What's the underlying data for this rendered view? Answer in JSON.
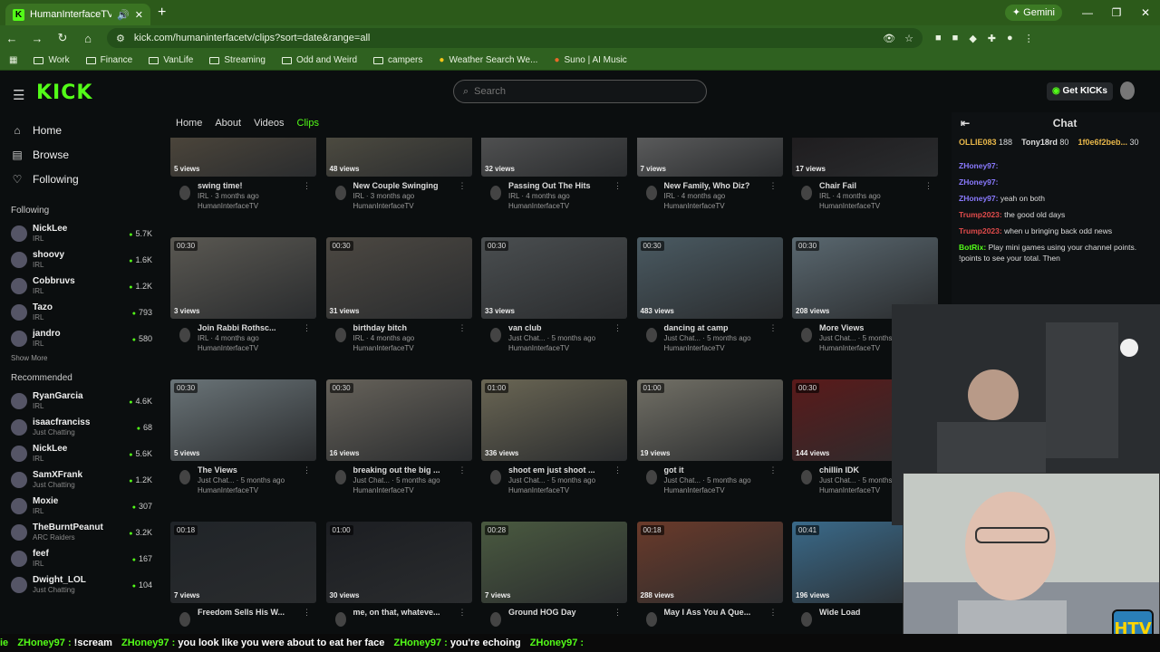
{
  "browser": {
    "tab_title": "HumanInterfaceTV Clips - V",
    "gemini_label": "Gemini",
    "url": "kick.com/humaninterfacetv/clips?sort=date&range=all",
    "bookmarks": [
      "Work",
      "Finance",
      "VanLife",
      "Streaming",
      "Odd and Weird",
      "campers",
      "Weather Search We...",
      "Suno | AI Music"
    ]
  },
  "site": {
    "logo": "KICK",
    "search_placeholder": "Search",
    "get_kicks": "Get KICKs"
  },
  "sidebar": {
    "nav": [
      "Home",
      "Browse",
      "Following"
    ],
    "following_header": "Following",
    "following": [
      {
        "name": "NickLee",
        "category": "IRL",
        "count": "5.7K"
      },
      {
        "name": "shoovy",
        "category": "IRL",
        "count": "1.6K"
      },
      {
        "name": "Cobbruvs",
        "category": "IRL",
        "count": "1.2K"
      },
      {
        "name": "Tazo",
        "category": "IRL",
        "count": "793"
      },
      {
        "name": "jandro",
        "category": "IRL",
        "count": "580"
      }
    ],
    "show_more": "Show More",
    "recommended_header": "Recommended",
    "recommended": [
      {
        "name": "RyanGarcia",
        "category": "IRL",
        "count": "4.6K"
      },
      {
        "name": "isaacfranciss",
        "category": "Just Chatting",
        "count": "68"
      },
      {
        "name": "NickLee",
        "category": "IRL",
        "count": "5.6K"
      },
      {
        "name": "SamXFrank",
        "category": "Just Chatting",
        "count": "1.2K"
      },
      {
        "name": "Moxie",
        "category": "IRL",
        "count": "307"
      },
      {
        "name": "TheBurntPeanut",
        "category": "ARC Raiders",
        "count": "3.2K"
      },
      {
        "name": "feef",
        "category": "IRL",
        "count": "167"
      },
      {
        "name": "Dwight_LOL",
        "category": "Just Chatting",
        "count": "104"
      }
    ]
  },
  "channel_tabs": [
    "Home",
    "About",
    "Videos",
    "Clips"
  ],
  "clips": [
    {
      "title": "swing time!",
      "meta": "IRL · 3 months ago",
      "user": "HumanInterfaceTV",
      "views": "5 views",
      "dur": "",
      "color": "#5a5040"
    },
    {
      "title": "New Couple Swinging",
      "meta": "IRL · 3 months ago",
      "user": "HumanInterfaceTV",
      "views": "48 views",
      "dur": "",
      "color": "#5c5848"
    },
    {
      "title": "Passing Out The Hits",
      "meta": "IRL · 4 months ago",
      "user": "HumanInterfaceTV",
      "views": "32 views",
      "dur": "",
      "color": "#606060"
    },
    {
      "title": "New Family, Who Diz?",
      "meta": "IRL · 4 months ago",
      "user": "HumanInterfaceTV",
      "views": "7 views",
      "dur": "",
      "color": "#707070"
    },
    {
      "title": "Chair Fail",
      "meta": "IRL · 4 months ago",
      "user": "HumanInterfaceTV",
      "views": "17 views",
      "dur": "",
      "color": "#1a1618"
    },
    {
      "title": "Join Rabbi Rothsc...",
      "meta": "IRL · 4 months ago",
      "user": "HumanInterfaceTV",
      "views": "3 views",
      "dur": "00:30",
      "color": "#5a5852"
    },
    {
      "title": "birthday bitch",
      "meta": "IRL · 4 months ago",
      "user": "HumanInterfaceTV",
      "views": "31 views",
      "dur": "00:30",
      "color": "#4c4842"
    },
    {
      "title": "van club",
      "meta": "Just Chat... · 5 months ago",
      "user": "HumanInterfaceTV",
      "views": "33 views",
      "dur": "00:30",
      "color": "#4a4e50"
    },
    {
      "title": "dancing at camp",
      "meta": "Just Chat... · 5 months ago",
      "user": "HumanInterfaceTV",
      "views": "483 views",
      "dur": "00:30",
      "color": "#4a5a62"
    },
    {
      "title": "More Views",
      "meta": "Just Chat... · 5 months ago",
      "user": "HumanInterfaceTV",
      "views": "208 views",
      "dur": "00:30",
      "color": "#5a6870"
    },
    {
      "title": "The Views",
      "meta": "Just Chat... · 5 months ago",
      "user": "HumanInterfaceTV",
      "views": "5 views",
      "dur": "00:30",
      "color": "#6a7478"
    },
    {
      "title": "breaking out the big ...",
      "meta": "Just Chat... · 5 months ago",
      "user": "HumanInterfaceTV",
      "views": "16 views",
      "dur": "00:30",
      "color": "#66625a"
    },
    {
      "title": "shoot em just shoot ...",
      "meta": "Just Chat... · 5 months ago",
      "user": "HumanInterfaceTV",
      "views": "336 views",
      "dur": "01:00",
      "color": "#6a6654"
    },
    {
      "title": "got it",
      "meta": "Just Chat... · 5 months ago",
      "user": "HumanInterfaceTV",
      "views": "19 views",
      "dur": "01:00",
      "color": "#727066"
    },
    {
      "title": "chillin IDK",
      "meta": "Just Chat... · 5 months ago",
      "user": "HumanInterfaceTV",
      "views": "144 views",
      "dur": "00:30",
      "color": "#5a1a1a"
    },
    {
      "title": "Freedom Sells His W...",
      "meta": "",
      "user": "",
      "views": "7 views",
      "dur": "00:18",
      "color": "#202428"
    },
    {
      "title": "me, on that, whateve...",
      "meta": "",
      "user": "",
      "views": "30 views",
      "dur": "01:00",
      "color": "#1c1e22"
    },
    {
      "title": "Ground HOG Day",
      "meta": "",
      "user": "",
      "views": "7 views",
      "dur": "00:28",
      "color": "#4a5a40"
    },
    {
      "title": "May I Ass You A Que...",
      "meta": "",
      "user": "",
      "views": "288 views",
      "dur": "00:18",
      "color": "#6a3a2a"
    },
    {
      "title": "Wide Load",
      "meta": "",
      "user": "",
      "views": "196 views",
      "dur": "00:41",
      "color": "#3a6a8a"
    }
  ],
  "chat": {
    "title": "Chat",
    "leaders": [
      {
        "name": "OLLIE083",
        "value": "188"
      },
      {
        "name": "Tony18rd",
        "value": "80"
      },
      {
        "name": "1f0e6f2beb...",
        "value": "30"
      }
    ],
    "messages": [
      {
        "user": "ZHoney97:",
        "text": "",
        "color": "#8a7aff"
      },
      {
        "user": "ZHoney97:",
        "text": "",
        "color": "#8a7aff"
      },
      {
        "user": "ZHoney97:",
        "text": "yeah on both",
        "color": "#8a7aff"
      },
      {
        "user": "Trump2023:",
        "text": "the good old days",
        "color": "#e14b4b"
      },
      {
        "user": "Trump2023:",
        "text": "when u bringing back odd news",
        "color": "#e14b4b"
      },
      {
        "user": "BotRix:",
        "text": "Play mini games using your channel points. !points to see your total. Then",
        "color": "#53fc18"
      }
    ]
  },
  "ticker": [
    {
      "user": "ie",
      "text": ""
    },
    {
      "user": "ZHoney97 :",
      "text": "!scream"
    },
    {
      "user": "ZHoney97 :",
      "text": "you look like you were about to eat her face"
    },
    {
      "user": "ZHoney97 :",
      "text": "you're echoing"
    },
    {
      "user": "ZHoney97 :",
      "text": ""
    }
  ],
  "overlay_logo": "HTV"
}
